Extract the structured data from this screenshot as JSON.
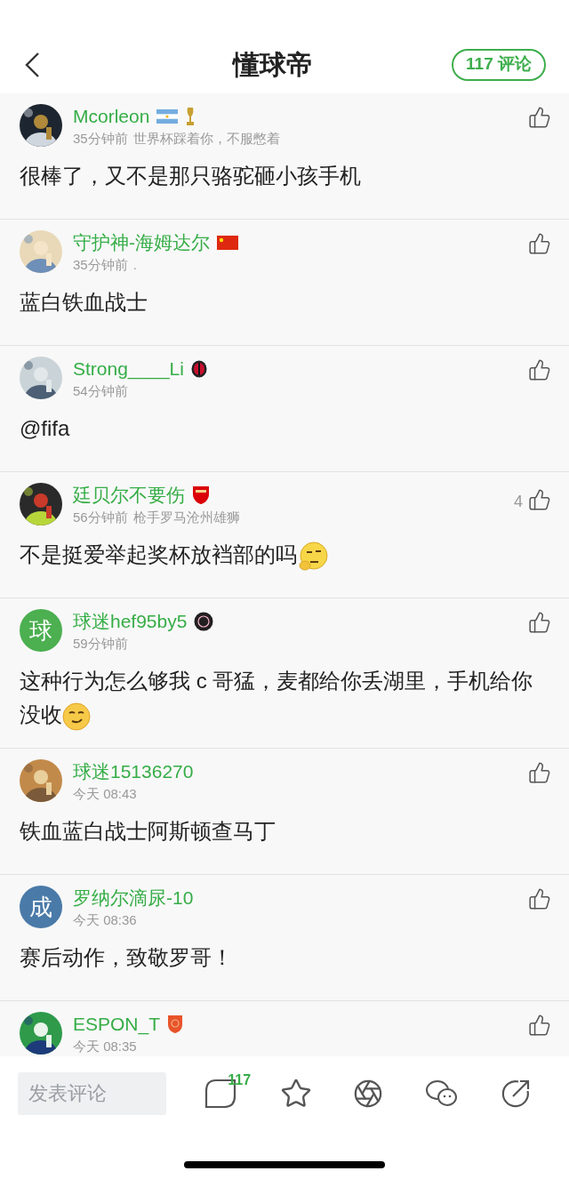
{
  "header": {
    "title": "懂球帝",
    "comments_button": "117 评论"
  },
  "comments": [
    {
      "user": "Mcorleon",
      "time": "35分钟前",
      "signature": "世界杯踩着你，不服憋着",
      "text": "很棒了，又不是那只骆驼砸小孩手机"
    },
    {
      "user": "守护神-海姆达尔",
      "time": "35分钟前",
      "signature": ".",
      "text": "蓝白铁血战士"
    },
    {
      "user": "Strong____Li",
      "time": "54分钟前",
      "text": "@fifa"
    },
    {
      "user": "廷贝尔不要伤",
      "time": "56分钟前",
      "signature": "枪手罗马沧州雄狮",
      "text": "不是挺爱举起奖杯放裆部的吗",
      "likes": "4",
      "emoji": {
        "kind": "thinking"
      }
    },
    {
      "user": "球迷hef95by5",
      "time": "59分钟前",
      "text": "这种行为怎么够我 c 哥猛，麦都给你丢湖里，手机给你没收",
      "emoji": {
        "kind": "smirk"
      },
      "avatar": {
        "kind": "letter",
        "text": "球",
        "color": "#4caf50"
      }
    },
    {
      "user": "球迷15136270",
      "time": "今天 08:43",
      "text": "铁血蓝白战士阿斯顿查马丁"
    },
    {
      "user": "罗纳尔滴尿-10",
      "time": "今天 08:36",
      "text": "赛后动作，致敬罗哥！",
      "avatar": {
        "kind": "letter",
        "text": "成",
        "color": "#4a7aa8"
      }
    },
    {
      "user": "ESPON_T",
      "time": "今天 08:35"
    }
  ],
  "bottom_bar": {
    "placeholder": "发表评论",
    "comment_count": "117"
  }
}
